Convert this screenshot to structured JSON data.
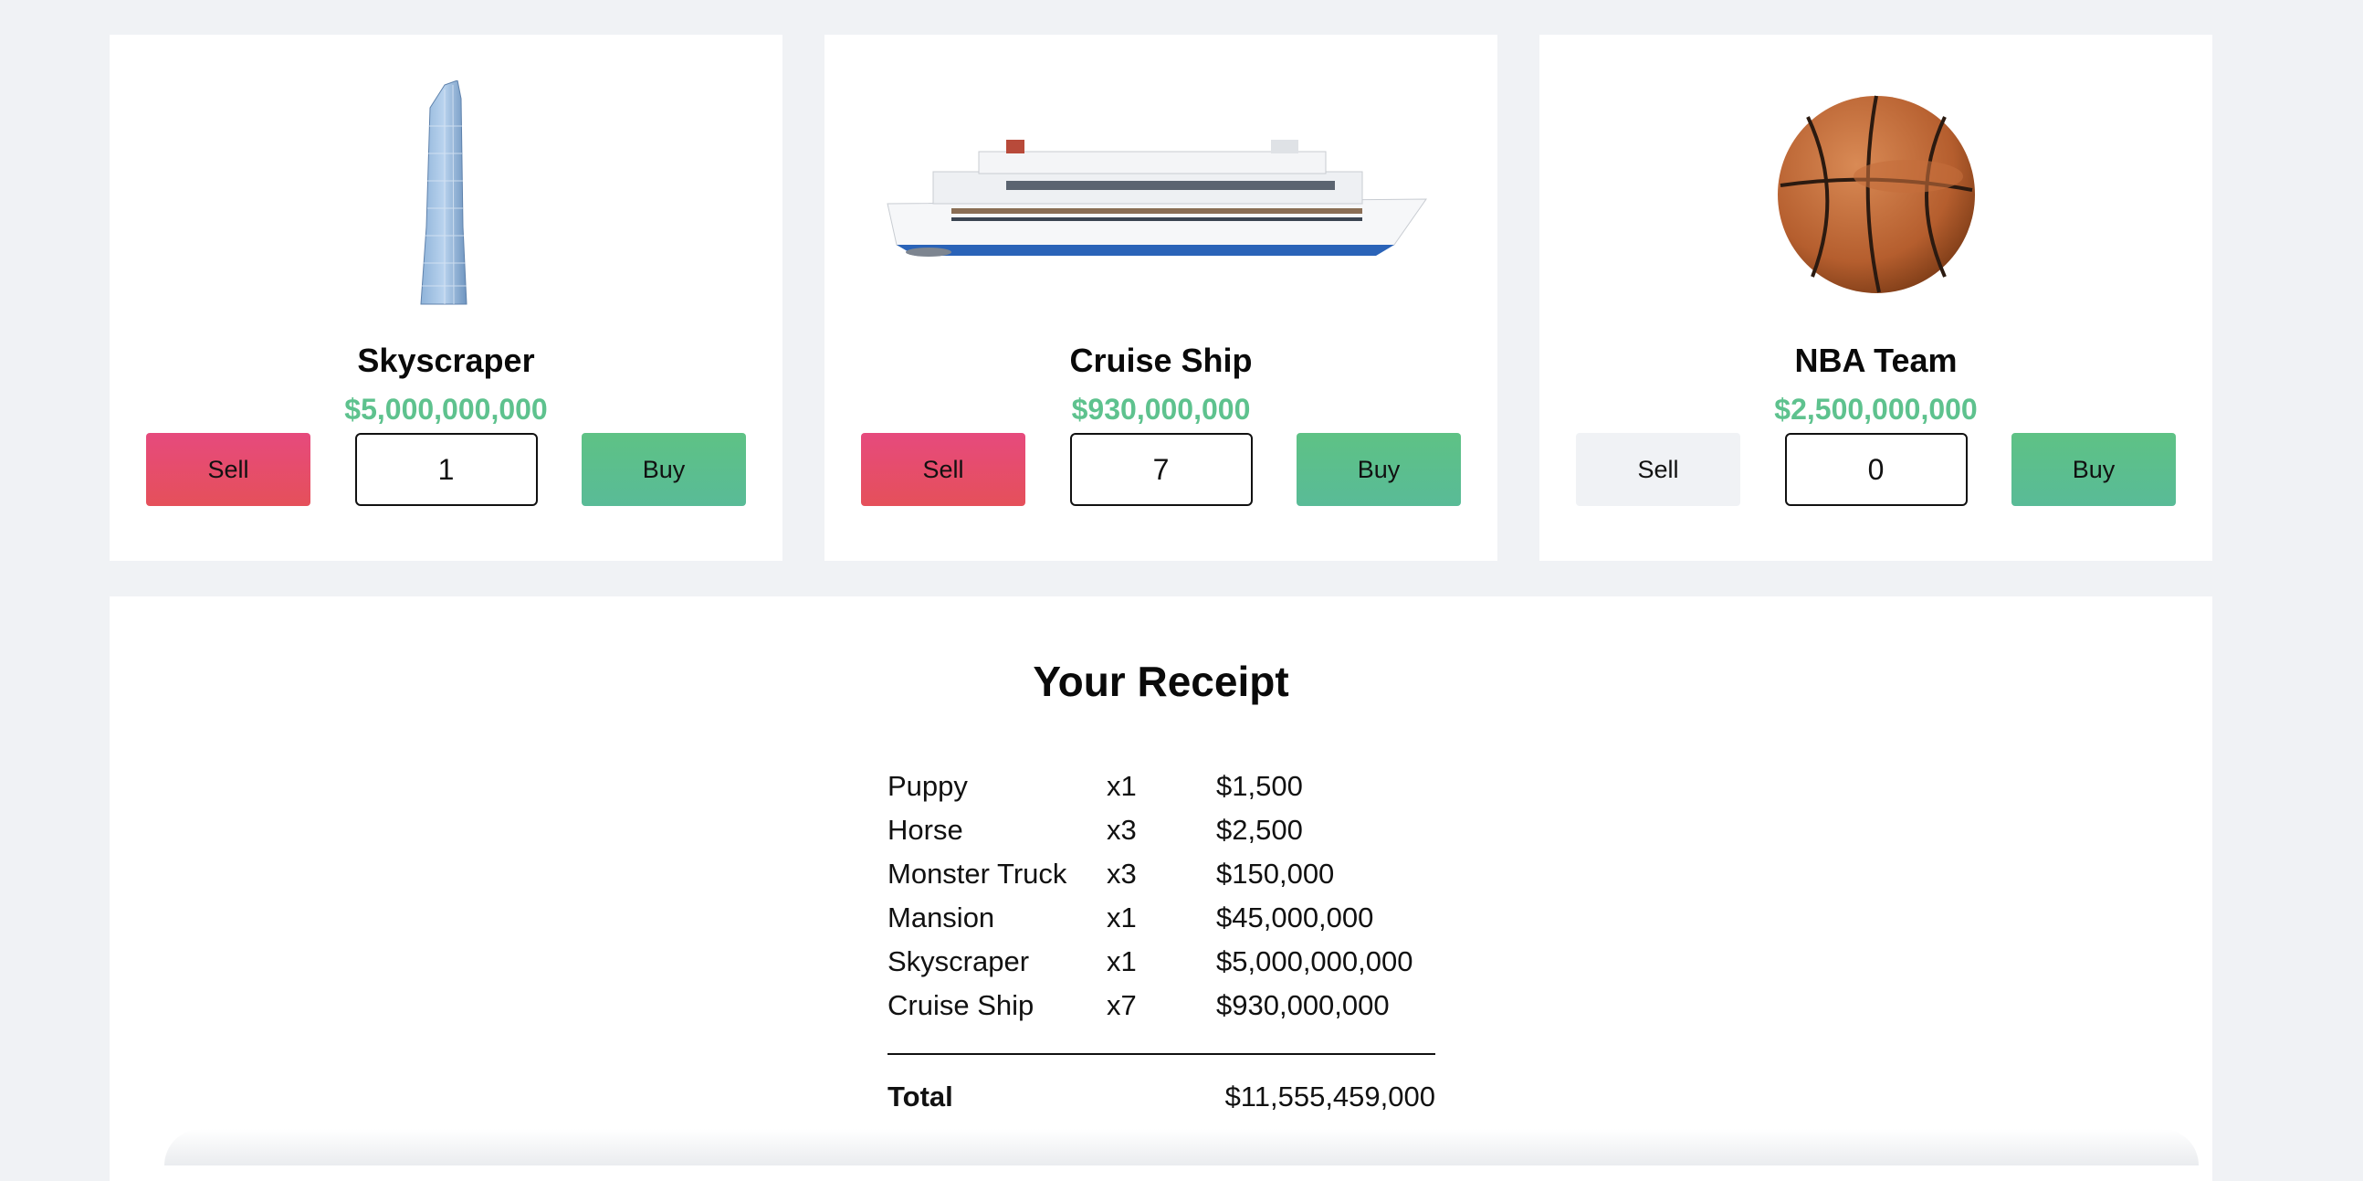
{
  "products": [
    {
      "icon": "skyscraper-icon",
      "name": "Skyscraper",
      "price": "$5,000,000,000",
      "quantity": "1",
      "sell_label": "Sell",
      "buy_label": "Buy",
      "sell_enabled": true
    },
    {
      "icon": "cruise-ship-icon",
      "name": "Cruise Ship",
      "price": "$930,000,000",
      "quantity": "7",
      "sell_label": "Sell",
      "buy_label": "Buy",
      "sell_enabled": true
    },
    {
      "icon": "basketball-icon",
      "name": "NBA Team",
      "price": "$2,500,000,000",
      "quantity": "0",
      "sell_label": "Sell",
      "buy_label": "Buy",
      "sell_enabled": false
    }
  ],
  "receipt": {
    "title": "Your Receipt",
    "items": [
      {
        "name": "Puppy",
        "qty": "x1",
        "amount": "$1,500"
      },
      {
        "name": "Horse",
        "qty": "x3",
        "amount": "$2,500"
      },
      {
        "name": "Monster Truck",
        "qty": "x3",
        "amount": "$150,000"
      },
      {
        "name": "Mansion",
        "qty": "x1",
        "amount": "$45,000,000"
      },
      {
        "name": "Skyscraper",
        "qty": "x1",
        "amount": "$5,000,000,000"
      },
      {
        "name": "Cruise Ship",
        "qty": "x7",
        "amount": "$930,000,000"
      }
    ],
    "total_label": "Total",
    "total_amount": "$11,555,459,000"
  },
  "colors": {
    "price": "#5ec28e",
    "sell": "#e64a7d",
    "buy": "#5ec285",
    "background": "#f0f2f5"
  }
}
